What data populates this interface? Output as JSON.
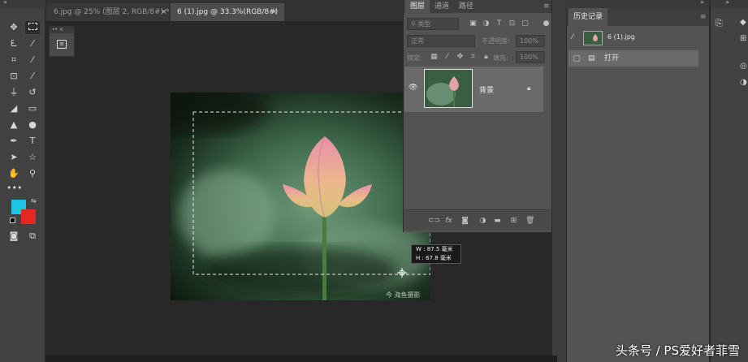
{
  "tabs": [
    {
      "label": "6.jpg @ 25% (图层 2, RGB/8#) *",
      "close": "×"
    },
    {
      "label": "6 (1).jpg @ 33.3%(RGB/8#)",
      "close": "×"
    }
  ],
  "layers_panel": {
    "tabs": [
      "图层",
      "通道",
      "路径"
    ],
    "search_placeholder": "类型",
    "blend_mode": "正常",
    "opacity_label": "不透明度:",
    "opacity_value": "100%",
    "lock_label": "锁定:",
    "fill_label": "填充:",
    "fill_value": "100%",
    "layer_name": "背景",
    "bottom_icons": [
      "link-icon",
      "fx-icon",
      "mask-icon",
      "adjustment-icon",
      "folder-icon",
      "new-layer-icon",
      "trash-icon"
    ],
    "fx_label": "fx"
  },
  "history_panel": {
    "title": "历史记录",
    "snapshot_name": "6 (1).jpg",
    "step_open": "打开"
  },
  "selection_info": {
    "w": "W : 87.5 毫米",
    "h": "H : 67.8 毫米"
  },
  "canvas_watermark": "今 海鱼摄影",
  "watermark": "头条号 / PS爱好者菲雪",
  "colors": {
    "foreground": "#1ec3e8",
    "background": "#e4281d"
  }
}
